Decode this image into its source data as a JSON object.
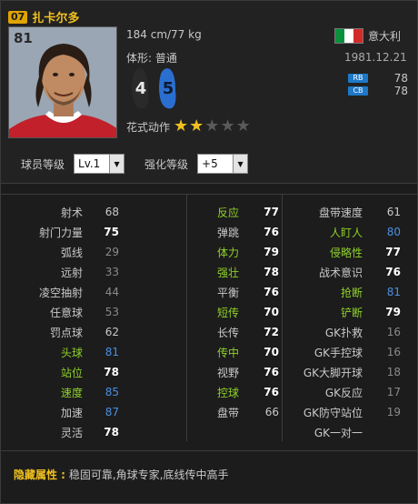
{
  "player": {
    "position": "07",
    "name": "扎卡尔多",
    "overall": "81",
    "height_weight": "184 cm/77 kg",
    "body_label": "体形:",
    "body": "普通",
    "left_foot": "4",
    "right_foot": "5",
    "nation": "意大利",
    "dob": "1981.12.21",
    "skill_label": "花式动作",
    "skill_stars": 2,
    "positions": [
      {
        "tag": "RB",
        "value": "78"
      },
      {
        "tag": "CB",
        "value": "78"
      }
    ]
  },
  "colors": {
    "flag": [
      "#0a8f3c",
      "#ffffff",
      "#d22b2b"
    ],
    "accent": "#f0c020",
    "green": "#8fd12a",
    "blue": "#4b8fe0"
  },
  "level": {
    "label": "球员等级",
    "value": "Lv.1"
  },
  "enhance": {
    "label": "强化等级",
    "value": "+5"
  },
  "stats": {
    "col1": [
      {
        "label": "射术",
        "value": "68",
        "lc": "n",
        "vc": "n"
      },
      {
        "label": "射门力量",
        "value": "75",
        "lc": "n",
        "vc": "w"
      },
      {
        "label": "弧线",
        "value": "29",
        "lc": "n",
        "vc": "d"
      },
      {
        "label": "远射",
        "value": "33",
        "lc": "n",
        "vc": "d"
      },
      {
        "label": "凌空抽射",
        "value": "44",
        "lc": "n",
        "vc": "d"
      },
      {
        "label": "任意球",
        "value": "53",
        "lc": "n",
        "vc": "d"
      },
      {
        "label": "罚点球",
        "value": "62",
        "lc": "n",
        "vc": "n"
      },
      {
        "label": "头球",
        "value": "81",
        "lc": "g",
        "vc": "b"
      },
      {
        "label": "站位",
        "value": "78",
        "lc": "g",
        "vc": "w"
      },
      {
        "label": "速度",
        "value": "85",
        "lc": "g",
        "vc": "b"
      },
      {
        "label": "加速",
        "value": "87",
        "lc": "n",
        "vc": "b"
      },
      {
        "label": "灵活",
        "value": "78",
        "lc": "n",
        "vc": "w"
      }
    ],
    "col2": [
      {
        "label": "反应",
        "value": "77",
        "lc": "g",
        "vc": "w"
      },
      {
        "label": "弹跳",
        "value": "76",
        "lc": "n",
        "vc": "w"
      },
      {
        "label": "体力",
        "value": "79",
        "lc": "g",
        "vc": "w"
      },
      {
        "label": "强壮",
        "value": "78",
        "lc": "g",
        "vc": "w"
      },
      {
        "label": "平衡",
        "value": "76",
        "lc": "n",
        "vc": "w"
      },
      {
        "label": "短传",
        "value": "70",
        "lc": "g",
        "vc": "w"
      },
      {
        "label": "长传",
        "value": "72",
        "lc": "n",
        "vc": "w"
      },
      {
        "label": "传中",
        "value": "70",
        "lc": "g",
        "vc": "w"
      },
      {
        "label": "视野",
        "value": "76",
        "lc": "n",
        "vc": "w"
      },
      {
        "label": "控球",
        "value": "76",
        "lc": "g",
        "vc": "w"
      },
      {
        "label": "盘带",
        "value": "66",
        "lc": "n",
        "vc": "n"
      }
    ],
    "col3": [
      {
        "label": "盘带速度",
        "value": "61",
        "lc": "n",
        "vc": "n"
      },
      {
        "label": "人盯人",
        "value": "80",
        "lc": "g",
        "vc": "b"
      },
      {
        "label": "侵略性",
        "value": "77",
        "lc": "g",
        "vc": "w"
      },
      {
        "label": "战术意识",
        "value": "76",
        "lc": "n",
        "vc": "w"
      },
      {
        "label": "抢断",
        "value": "81",
        "lc": "g",
        "vc": "b"
      },
      {
        "label": "铲断",
        "value": "79",
        "lc": "g",
        "vc": "w"
      },
      {
        "label": "GK扑救",
        "value": "16",
        "lc": "n",
        "vc": "d"
      },
      {
        "label": "GK手控球",
        "value": "16",
        "lc": "n",
        "vc": "d"
      },
      {
        "label": "GK大脚开球",
        "value": "18",
        "lc": "n",
        "vc": "d"
      },
      {
        "label": "GK反应",
        "value": "17",
        "lc": "n",
        "vc": "d"
      },
      {
        "label": "GK防守站位",
        "value": "19",
        "lc": "n",
        "vc": "d"
      },
      {
        "label": "GK一对一",
        "value": "",
        "lc": "n",
        "vc": "d"
      }
    ]
  },
  "hidden_traits": {
    "label": "隐藏属性 :",
    "value": "稳固可靠,角球专家,底线传中高手"
  }
}
